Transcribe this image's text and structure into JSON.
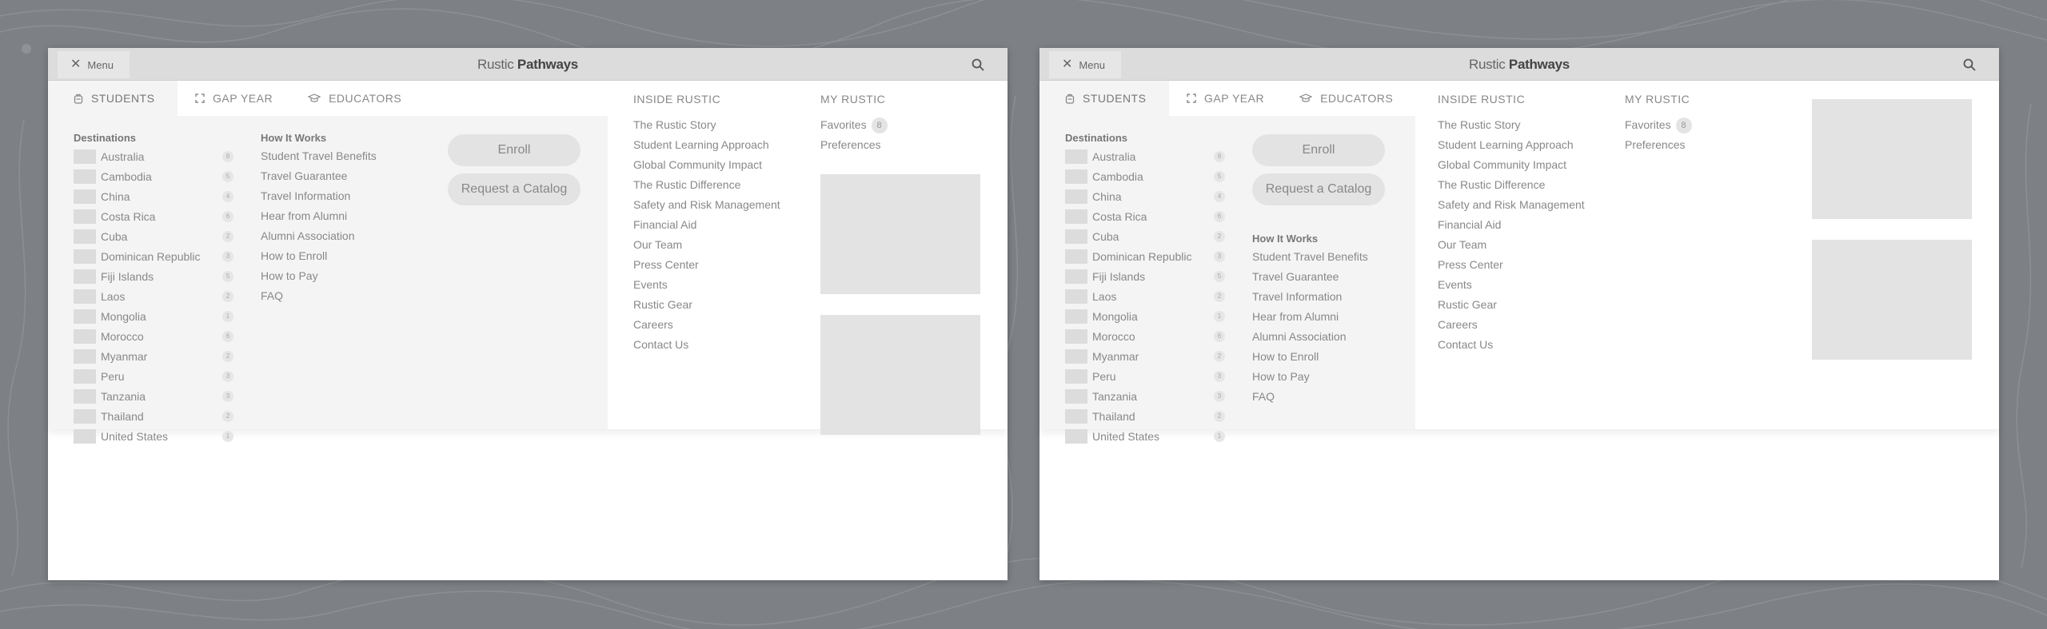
{
  "brand": {
    "logo_light": "Rustic",
    "logo_bold": "Pathways"
  },
  "topbar": {
    "menu_label": "Menu"
  },
  "tabs": [
    {
      "label": "STUDENTS",
      "icon": "backpack-icon",
      "active": true
    },
    {
      "label": "GAP YEAR",
      "icon": "grid-icon",
      "active": false
    },
    {
      "label": "EDUCATORS",
      "icon": "graduation-cap-icon",
      "active": false
    }
  ],
  "destinations": {
    "title": "Destinations",
    "items": [
      {
        "name": "Australia",
        "count": "8"
      },
      {
        "name": "Cambodia",
        "count": "5"
      },
      {
        "name": "China",
        "count": "4"
      },
      {
        "name": "Costa Rica",
        "count": "6"
      },
      {
        "name": "Cuba",
        "count": "2"
      },
      {
        "name": "Dominican Republic",
        "count": "3"
      },
      {
        "name": "Fiji Islands",
        "count": "5"
      },
      {
        "name": "Laos",
        "count": "2"
      },
      {
        "name": "Mongolia",
        "count": "1"
      },
      {
        "name": "Morocco",
        "count": "6"
      },
      {
        "name": "Myanmar",
        "count": "2"
      },
      {
        "name": "Peru",
        "count": "3"
      },
      {
        "name": "Tanzania",
        "count": "3"
      },
      {
        "name": "Thailand",
        "count": "2"
      },
      {
        "name": "United States",
        "count": "1"
      }
    ]
  },
  "how_it_works": {
    "title": "How It Works",
    "items": [
      "Student Travel Benefits",
      "Travel Guarantee",
      "Travel Information",
      "Hear from Alumni",
      "Alumni Association",
      "How to Enroll",
      "How to Pay",
      "FAQ"
    ]
  },
  "actions": {
    "enroll": "Enroll",
    "catalog": "Request a Catalog"
  },
  "inside_rustic": {
    "title": "INSIDE RUSTIC",
    "items": [
      "The Rustic Story",
      "Student Learning Approach",
      "Global Community Impact",
      "The Rustic Difference",
      "Safety and Risk Management",
      "Financial Aid",
      "Our Team",
      "Press Center",
      "Events",
      "Rustic Gear",
      "Careers",
      "Contact Us"
    ]
  },
  "my_rustic": {
    "title": "MY RUSTIC",
    "favorites_label": "Favorites",
    "favorites_count": "8",
    "preferences_label": "Preferences"
  }
}
